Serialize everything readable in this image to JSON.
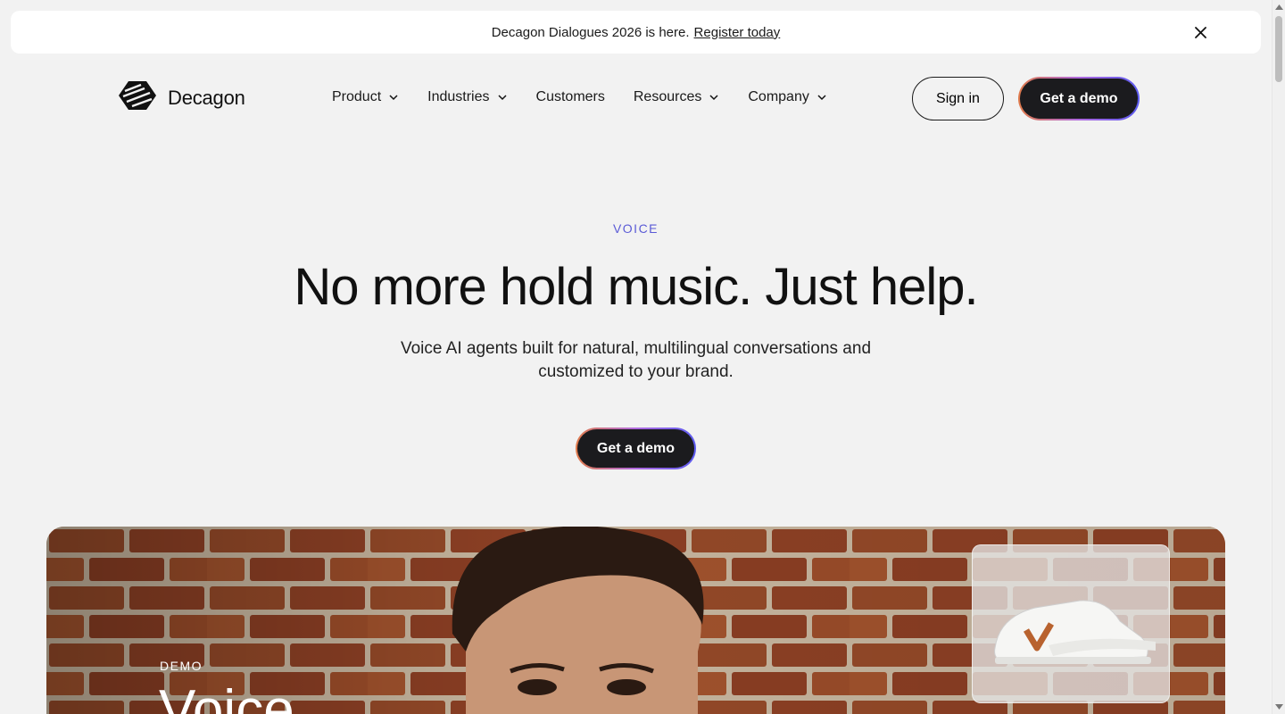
{
  "announcement": {
    "text": "Decagon Dialogues 2026 is here.",
    "link": "Register today",
    "close_icon": "close-icon"
  },
  "header": {
    "logo_text": "Decagon",
    "logo_icon": "decagon-logo-icon",
    "nav": [
      {
        "label": "Product",
        "has_dropdown": true
      },
      {
        "label": "Industries",
        "has_dropdown": true
      },
      {
        "label": "Customers",
        "has_dropdown": false
      },
      {
        "label": "Resources",
        "has_dropdown": true
      },
      {
        "label": "Company",
        "has_dropdown": true
      }
    ],
    "sign_in": "Sign in",
    "get_demo": "Get a demo"
  },
  "hero": {
    "eyebrow": "VOICE",
    "title": "No more hold music. Just help.",
    "subtitle_line1": "Voice AI agents built for natural, multilingual conversations and",
    "subtitle_line2": "customized to your brand.",
    "cta": "Get a demo"
  },
  "video": {
    "label": "DEMO",
    "title": "Voice"
  },
  "colors": {
    "accent": "#5b5bd6",
    "button_dark": "#1b1b1e",
    "background": "#f2f2f2",
    "brick": "#8a3f22"
  }
}
